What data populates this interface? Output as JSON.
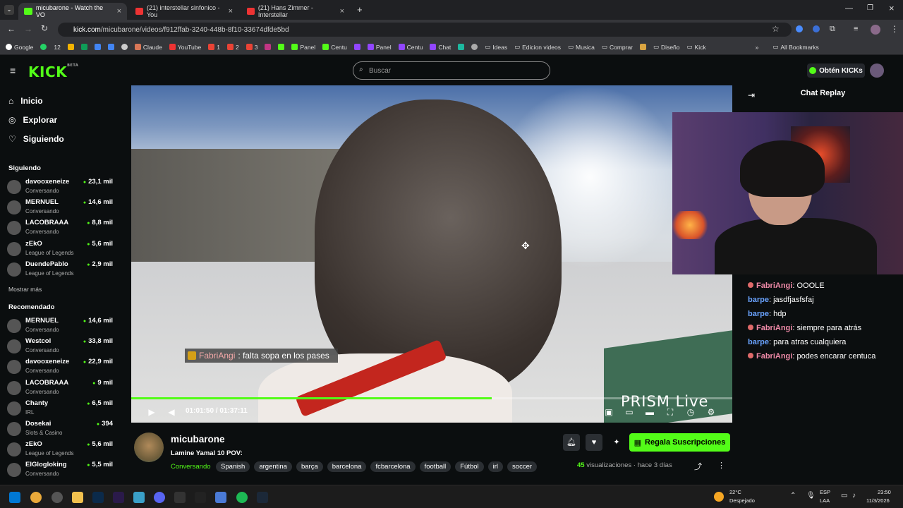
{
  "browser": {
    "tabs": [
      {
        "title": "micubarone - Watch the VO"
      },
      {
        "title": "(21) interstellar sinfonico - You"
      },
      {
        "title": "(21) Hans Zimmer - Interstellar"
      }
    ],
    "url_host": "kick.com",
    "url_path": "/micubarone/videos/f912ffab-3240-448b-8f10-33674dfde5bd",
    "bookmarks": [
      "Google",
      "12",
      "Claude",
      "YouTube",
      "1",
      "2",
      "3",
      "Panel",
      "Centu",
      "Panel",
      "Centu",
      "Chat",
      "Ideas",
      "Edicion videos",
      "Musica",
      "Comprar",
      "Diseño",
      "Kick"
    ],
    "all_bookmarks": "All Bookmarks"
  },
  "header": {
    "logo": "KICK",
    "beta": "BETA",
    "search_placeholder": "Buscar",
    "get_kicks": "Obtén KICKs"
  },
  "sidebar": {
    "nav": [
      "Inicio",
      "Explorar",
      "Siguiendo"
    ],
    "following_title": "Siguiendo",
    "following": [
      {
        "name": "davooxeneize",
        "category": "Conversando",
        "viewers": "23,1 mil"
      },
      {
        "name": "MERNUEL",
        "category": "Conversando",
        "viewers": "14,6 mil"
      },
      {
        "name": "LACOBRAAA",
        "category": "Conversando",
        "viewers": "8,8 mil"
      },
      {
        "name": "zEkO",
        "category": "League of Legends",
        "viewers": "5,6 mil"
      },
      {
        "name": "DuendePablo",
        "category": "League of Legends",
        "viewers": "2,9 mil"
      }
    ],
    "show_more": "Mostrar más",
    "recommended_title": "Recomendado",
    "recommended": [
      {
        "name": "MERNUEL",
        "category": "Conversando",
        "viewers": "14,6 mil"
      },
      {
        "name": "Westcol",
        "category": "Conversando",
        "viewers": "33,8 mil"
      },
      {
        "name": "davooxeneize",
        "category": "Conversando",
        "viewers": "22,9 mil"
      },
      {
        "name": "LACOBRAAA",
        "category": "Conversando",
        "viewers": "9 mil"
      },
      {
        "name": "Chanty",
        "category": "IRL",
        "viewers": "6,5 mil"
      },
      {
        "name": "Dosekai",
        "category": "Slots & Casino",
        "viewers": "394"
      },
      {
        "name": "zEkO",
        "category": "League of Legends",
        "viewers": "5,6 mil"
      },
      {
        "name": "ElGlogloking",
        "category": "Conversando",
        "viewers": "5,5 mil"
      }
    ]
  },
  "video": {
    "chat_overlay_user": "FabriAngi",
    "chat_overlay_text": ": falta sopa en los pases",
    "watermark": "PRISM Live",
    "time": "01:01:50 / 01:37:11",
    "progress": 0.6
  },
  "chat": {
    "title": "Chat Replay",
    "messages": [
      {
        "user": "FabriAngi",
        "text": ": OOOLE",
        "color": "u1"
      },
      {
        "user": "barpe",
        "text": ": jasdfjasfsfaj",
        "color": "u2"
      },
      {
        "user": "barpe",
        "text": ": hdp",
        "color": "u2"
      },
      {
        "user": "FabriAngi",
        "text": ": siempre para atrás",
        "color": "u1"
      },
      {
        "user": "barpe",
        "text": ": para atras cualquiera",
        "color": "u2"
      },
      {
        "user": "FabriAngi",
        "text": ": podes encarar centuca",
        "color": "u1"
      }
    ]
  },
  "channel": {
    "name": "micubarone",
    "title": "Lamine Yamal 10 POV:",
    "category": "Conversando",
    "tags": [
      "Spanish",
      "argentina",
      "barça",
      "barcelona",
      "fcbarcelona",
      "football",
      "Fútbol",
      "irl",
      "soccer"
    ],
    "subscribe": "Regala Suscripciones",
    "views_count": "45",
    "views_label": "visualizaciones",
    "age": "hace 3 días"
  },
  "taskbar": {
    "weather_temp": "22°C",
    "weather_desc": "Despejado",
    "lang1": "ESP",
    "lang2": "LAA",
    "time": "23:50",
    "date": "11/3/2026"
  },
  "colors": {
    "accent": "#53fc18",
    "bg": "#0b0e0f"
  }
}
